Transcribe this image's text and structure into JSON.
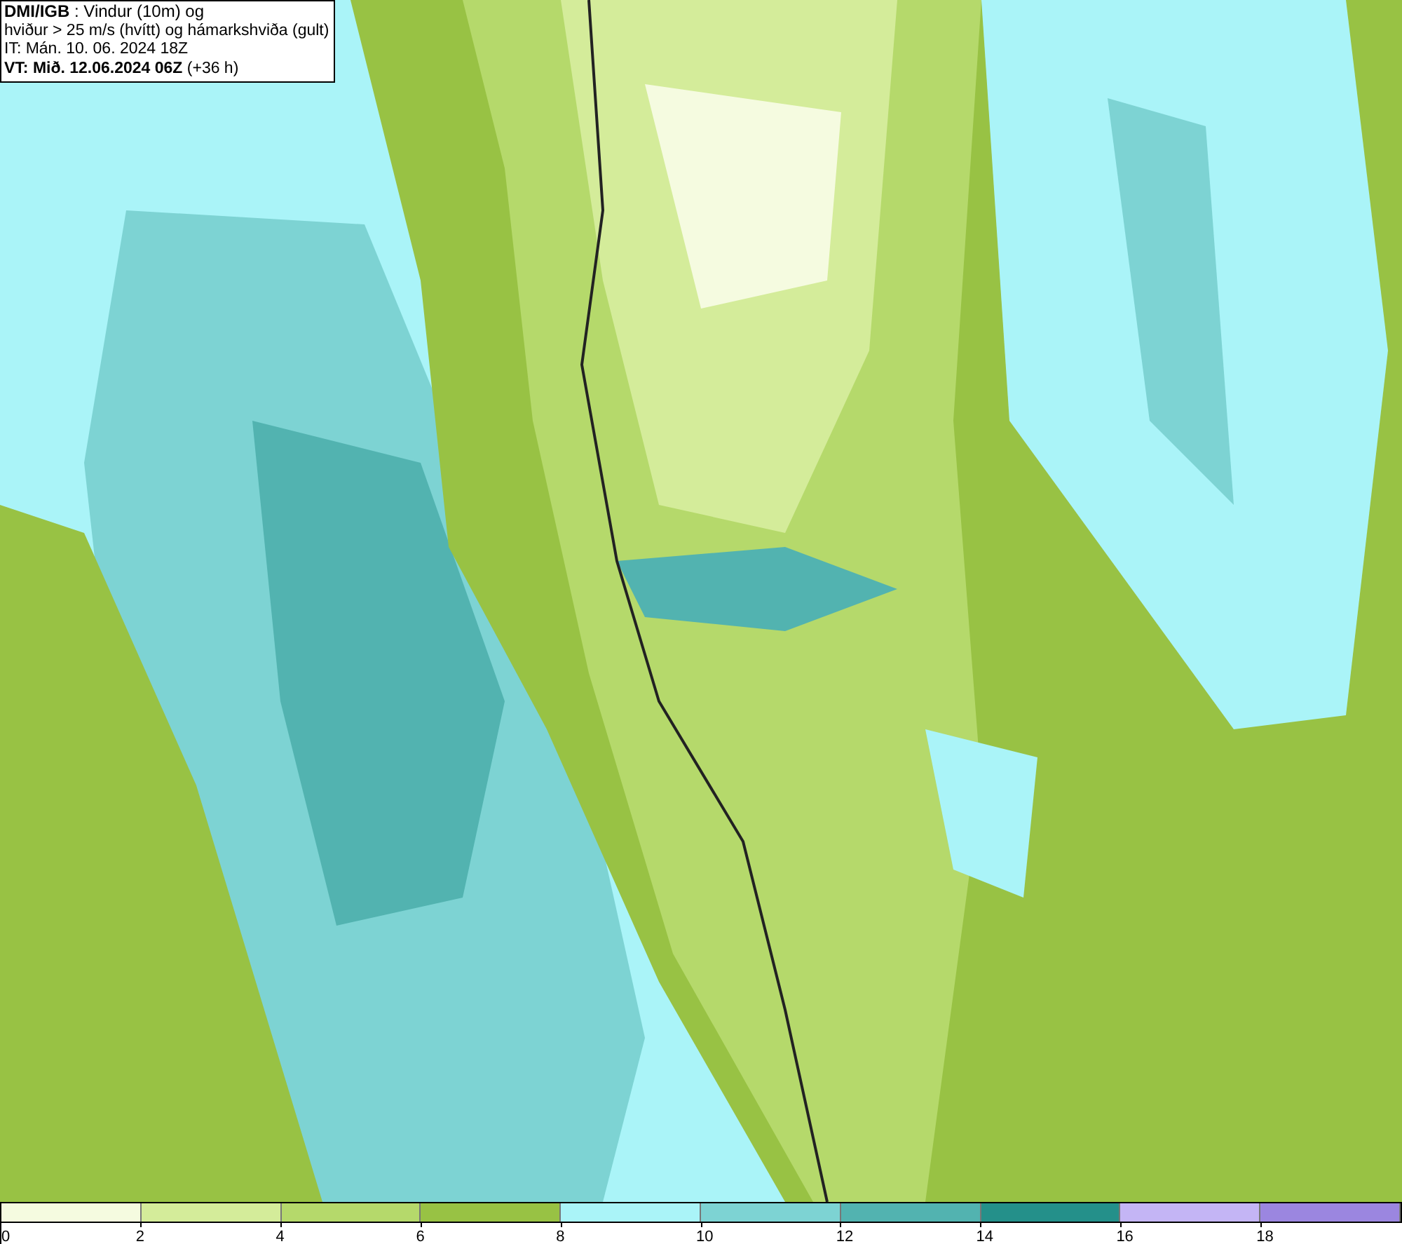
{
  "title_box": {
    "lines": [
      "**DMI/IGB** : Vindur (10m) og",
      "hviður > 25 m/s (hvítt) og hámarkshviða (gult)",
      "IT: Mán. 10. 06. 2024 18Z",
      "**VT: Mið. 12.06.2024 06Z** (+36 h)"
    ]
  },
  "color_scale": {
    "bins": [
      {
        "color": "#f5fbe0"
      },
      {
        "color": "#d4ec9a"
      },
      {
        "color": "#b5d96b"
      },
      {
        "color": "#98c244"
      },
      {
        "color": "#aaf4f8"
      },
      {
        "color": "#7dd3d3"
      },
      {
        "color": "#52b3b0"
      },
      {
        "color": "#24908a"
      },
      {
        "color": "#c4b5f5"
      },
      {
        "color": "#9b86e0"
      }
    ],
    "labels": [
      "0",
      "2",
      "4",
      "6",
      "8",
      "10",
      "12",
      "14",
      "16",
      "18"
    ]
  }
}
